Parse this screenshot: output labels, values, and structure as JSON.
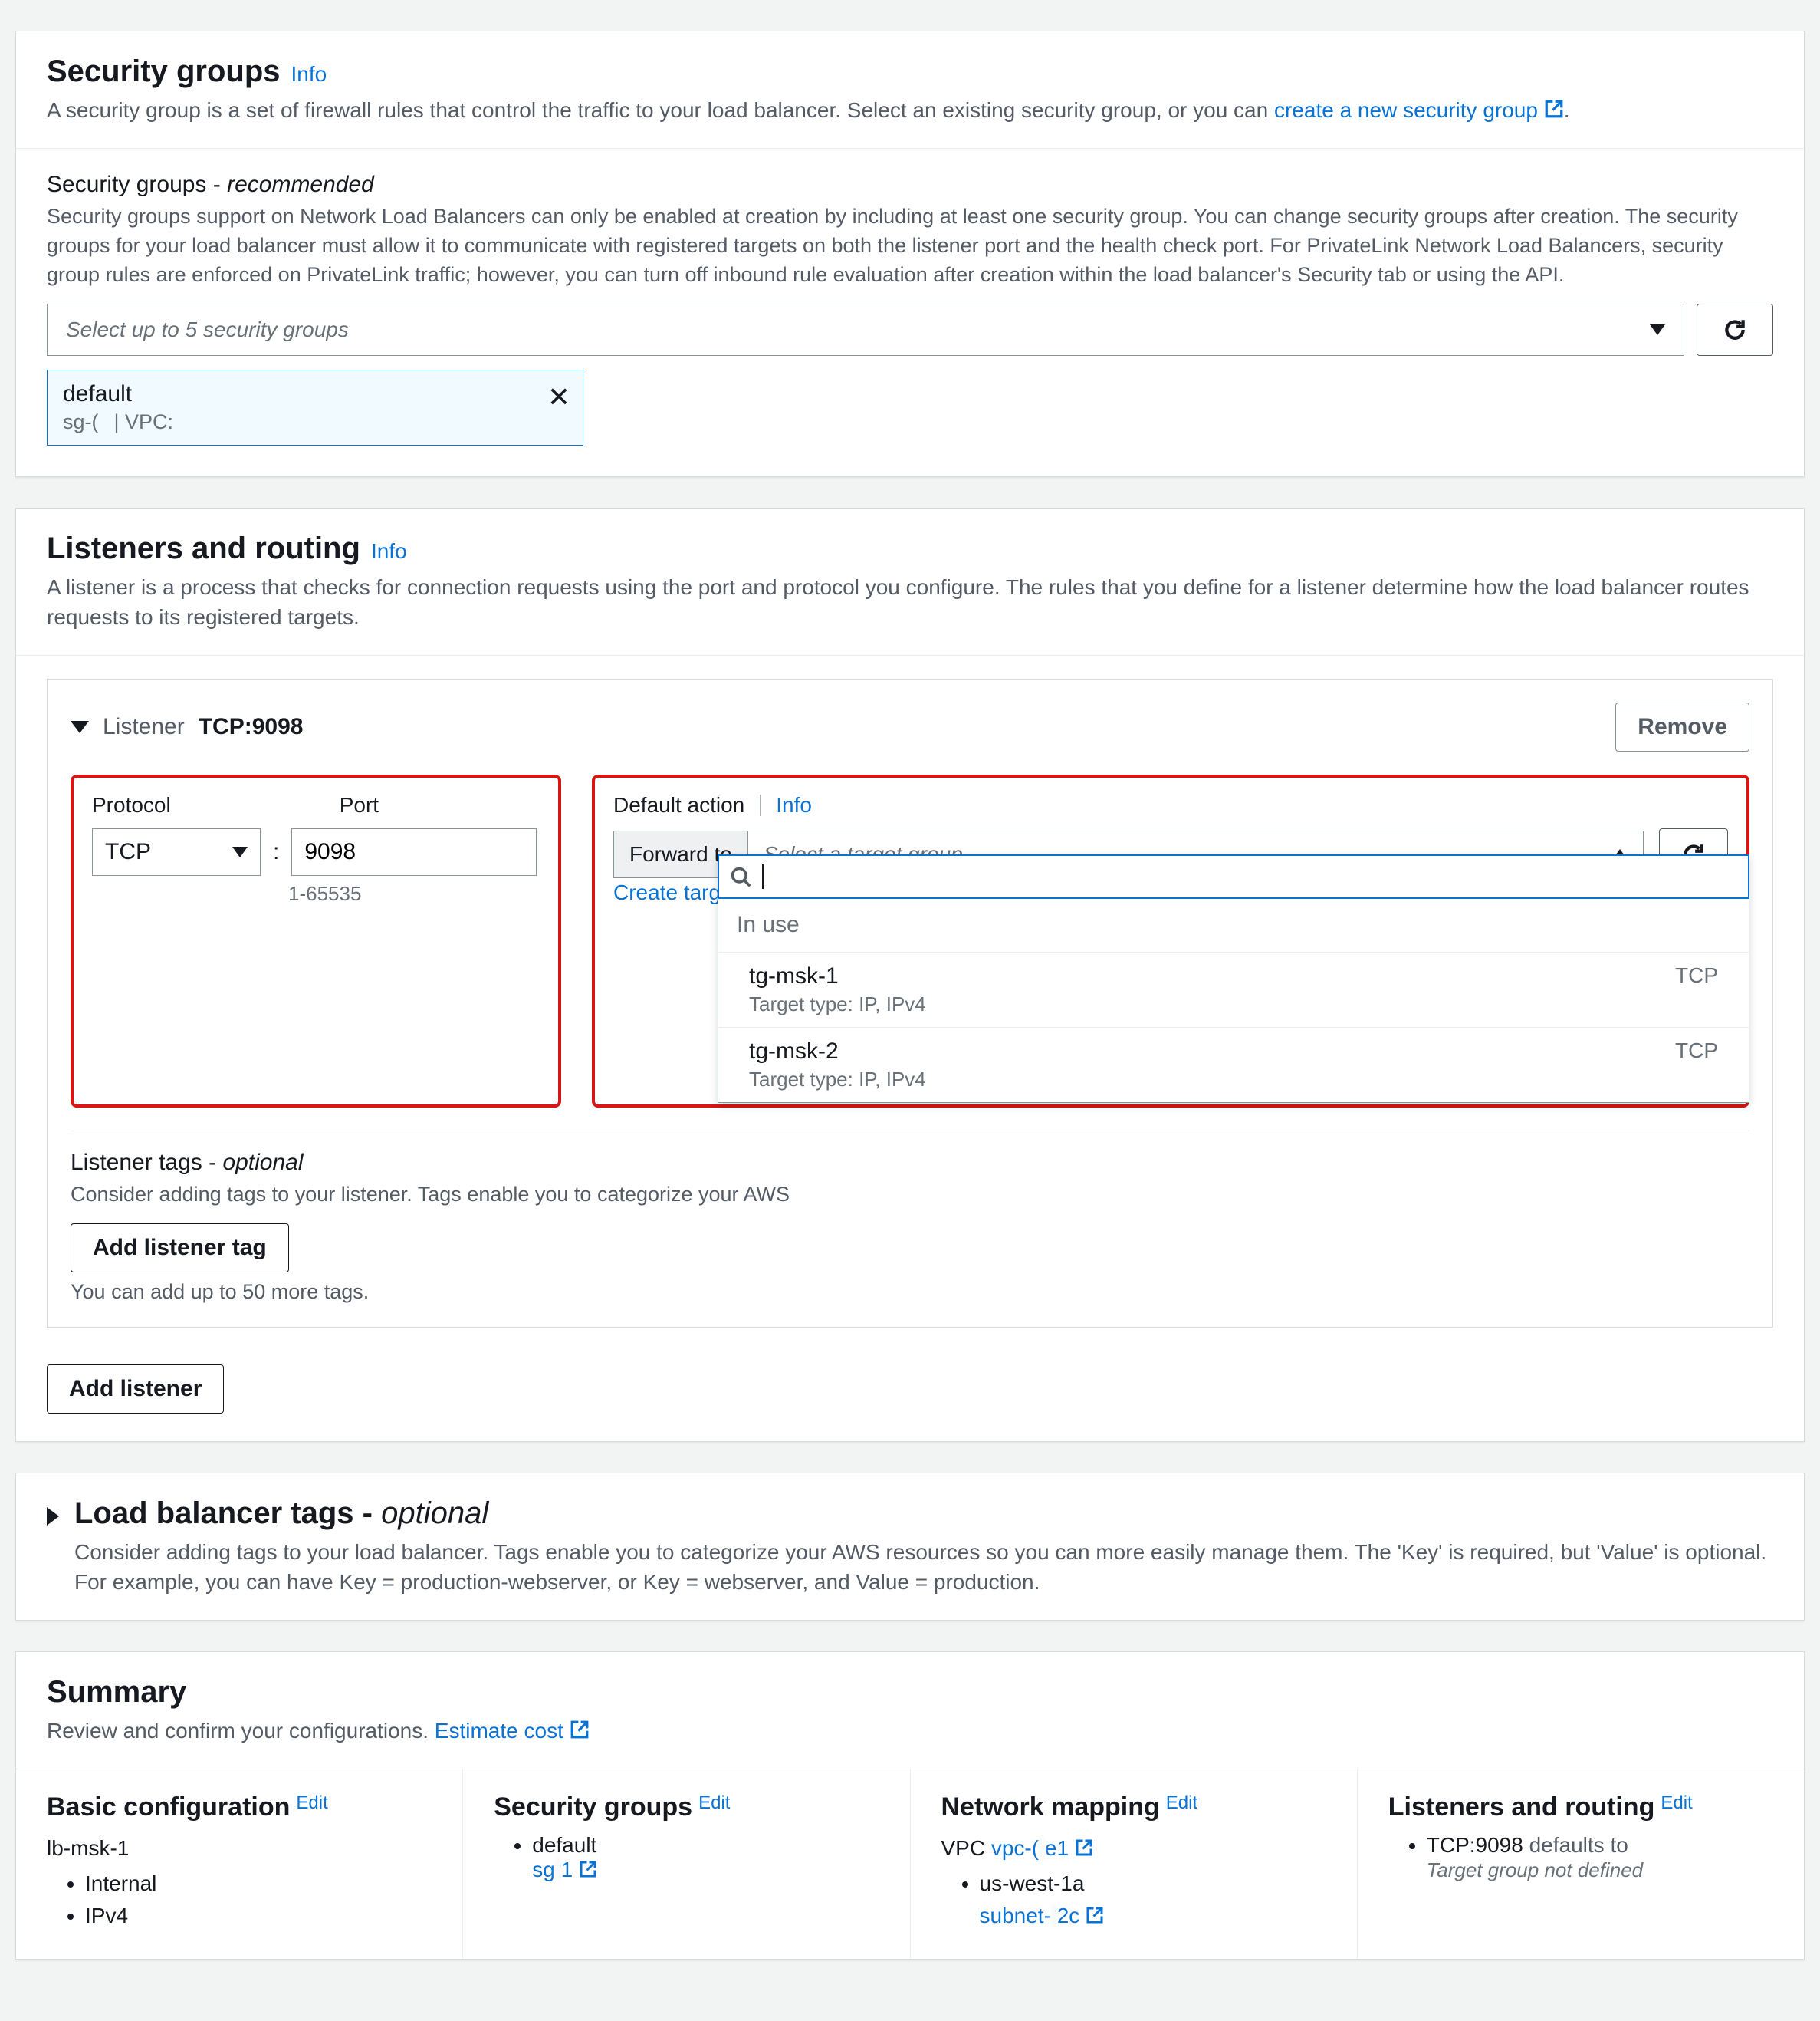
{
  "security_groups": {
    "title": "Security groups",
    "info": "Info",
    "desc_pre": "A security group is a set of firewall rules that control the traffic to your load balancer. Select an existing security group, or you can ",
    "create_link": "create a new security group",
    "desc_post": ".",
    "sub_title_pre": "Security groups - ",
    "sub_title_rec": "recommended",
    "sub_desc": "Security groups support on Network Load Balancers can only be enabled at creation by including at least one security group. You can change security groups after creation. The security groups for your load balancer must allow it to communicate with registered targets on both the listener port and the health check port. For PrivateLink Network Load Balancers, security group rules are enforced on PrivateLink traffic; however, you can turn off inbound rule evaluation after creation within the load balancer's Security tab or using the API.",
    "select_placeholder": "Select up to 5 security groups",
    "chip": {
      "name": "default",
      "sg_prefix": "sg-(",
      "sg_redacted": "                          ",
      "vpc_label": "|    VPC:",
      "vpc_redacted": "                                   "
    }
  },
  "listeners": {
    "title": "Listeners and routing",
    "info": "Info",
    "desc": "A listener is a process that checks for connection requests using the port and protocol you configure. The rules that you define for a listener determine how the load balancer routes requests to its registered targets.",
    "listener_label_pre": "Listener",
    "listener_label_main": "TCP:9098",
    "remove": "Remove",
    "protocol_label": "Protocol",
    "port_label": "Port",
    "protocol_value": "TCP",
    "port_value": "9098",
    "port_hint": "1-65535",
    "default_action": "Default action",
    "da_info": "Info",
    "forward_to": "Forward to",
    "tg_placeholder": "Select a target group",
    "create_target": "Create target",
    "dropdown": {
      "group": "In use",
      "options": [
        {
          "name": "tg-msk-1",
          "sub": "Target type: IP, IPv4",
          "proto": "TCP"
        },
        {
          "name": "tg-msk-2",
          "sub": "Target type: IP, IPv4",
          "proto": "TCP"
        }
      ]
    },
    "tags_title_pre": "Listener tags - ",
    "tags_title_opt": "optional",
    "tags_desc": "Consider adding tags to your listener. Tags enable you to categorize your AWS",
    "add_tag_btn": "Add listener tag",
    "tags_note": "You can add up to 50 more tags.",
    "add_listener": "Add listener"
  },
  "lb_tags": {
    "title_pre": "Load balancer tags - ",
    "title_opt": "optional",
    "desc": "Consider adding tags to your load balancer. Tags enable you to categorize your AWS resources so you can more easily manage them. The 'Key' is required, but 'Value' is optional. For example, you can have Key = production-webserver, or Key = webserver, and Value = production."
  },
  "summary": {
    "title": "Summary",
    "desc_pre": "Review and confirm your configurations. ",
    "estimate": "Estimate cost",
    "edit": "Edit",
    "basic": {
      "title": "Basic configuration",
      "name": "lb-msk-1",
      "items": [
        "Internal",
        "IPv4"
      ]
    },
    "sg": {
      "title": "Security groups",
      "item": "default",
      "sg_link_pre": "sg",
      "sg_link_redact": "                                  ",
      "sg_link_suf": "1"
    },
    "network": {
      "title": "Network mapping",
      "vpc_label": "VPC",
      "vpc_pre": "vpc-(",
      "vpc_redact": "                        ",
      "vpc_suf": "e1",
      "az": "us-west-1a",
      "subnet_pre": "subnet-",
      "subnet_redact": "                     ",
      "subnet_suf": "2c"
    },
    "lr": {
      "title": "Listeners and routing",
      "item": "TCP:9098",
      "defaults": "defaults to",
      "not_defined": "Target group not defined"
    }
  }
}
